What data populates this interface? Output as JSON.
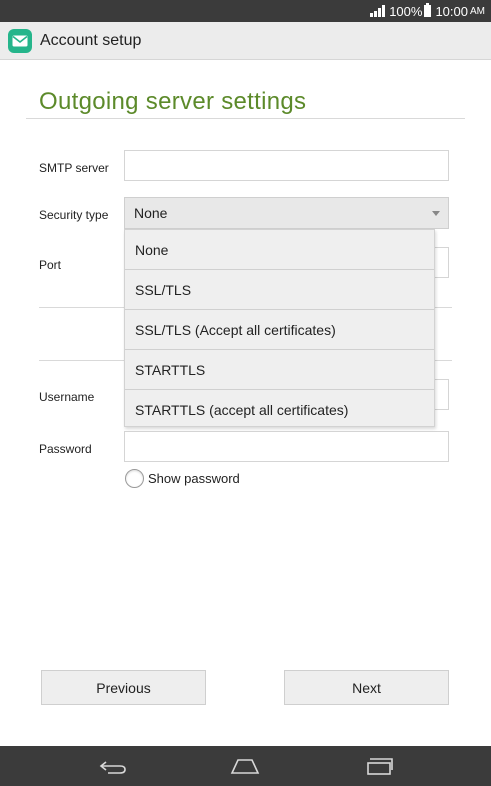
{
  "status_bar": {
    "battery_percent": "100%",
    "time": "10:00",
    "ampm": "AM"
  },
  "action_bar": {
    "title": "Account setup",
    "app_icon": "mail-icon",
    "accent_color": "#25b58b"
  },
  "page": {
    "title": "Outgoing server settings",
    "title_color": "#5c8a2a"
  },
  "form": {
    "smtp_label": "SMTP server",
    "smtp_value": "",
    "security_label": "Security type",
    "security_value": "None",
    "port_label": "Port",
    "username_label": "Username",
    "password_label": "Password",
    "show_password_label": "Show password"
  },
  "dropdown": {
    "options": [
      "None",
      "SSL/TLS",
      "SSL/TLS (Accept all certificates)",
      "STARTTLS",
      "STARTTLS (accept all certificates)"
    ]
  },
  "buttons": {
    "previous": "Previous",
    "next": "Next"
  },
  "nav_bar": {
    "icons": [
      "back-icon",
      "home-icon",
      "recent-apps-icon"
    ]
  }
}
